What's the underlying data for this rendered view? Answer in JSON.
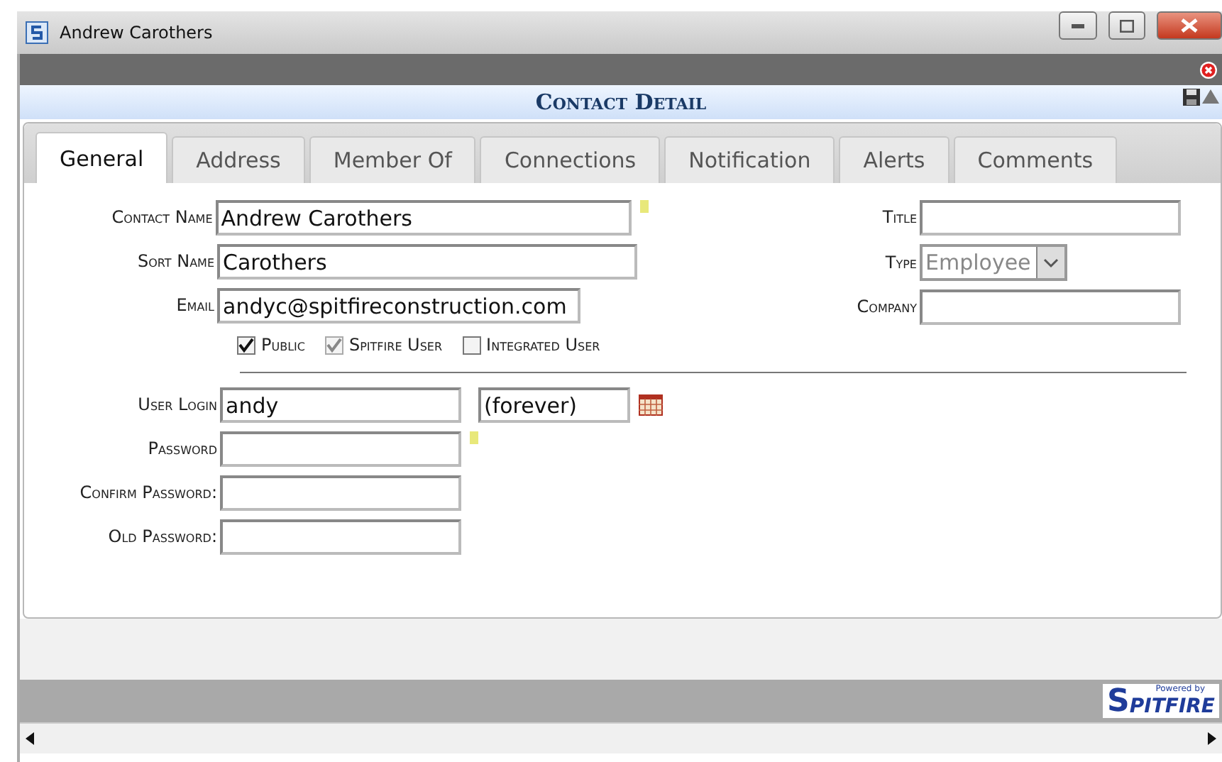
{
  "window": {
    "title": "Andrew Carothers"
  },
  "header": {
    "title": "Contact Detail"
  },
  "tabs": [
    {
      "label": "General",
      "selected": true
    },
    {
      "label": "Address",
      "selected": false
    },
    {
      "label": "Member Of",
      "selected": false
    },
    {
      "label": "Connections",
      "selected": false
    },
    {
      "label": "Notification",
      "selected": false
    },
    {
      "label": "Alerts",
      "selected": false
    },
    {
      "label": "Comments",
      "selected": false
    }
  ],
  "left_fields": [
    {
      "label": "Contact Name",
      "value": "Andrew Carothers",
      "help": true,
      "short": false
    },
    {
      "label": "Sort Name",
      "value": "Carothers",
      "help": false,
      "short": false
    },
    {
      "label": "Email",
      "value": "andyc@spitfireconstruction.com",
      "help": false,
      "short": true
    }
  ],
  "right_fields": [
    {
      "label": "Title",
      "kind": "text"
    },
    {
      "label": "Type",
      "kind": "select",
      "value": "Employee"
    },
    {
      "label": "Company",
      "kind": "text"
    }
  ],
  "checkboxes": [
    {
      "label": "Public",
      "checked": true,
      "disabled": false
    },
    {
      "label": "Spitfire User",
      "checked": true,
      "disabled": true
    },
    {
      "label": "Integrated User",
      "checked": false,
      "disabled": false
    }
  ],
  "login": {
    "label": "User Login",
    "value": "andy",
    "expiry": "(forever)"
  },
  "password_fields": [
    {
      "label": "Password",
      "help": true
    },
    {
      "label": "Confirm Password:",
      "help": false
    },
    {
      "label": "Old Password:",
      "help": false
    }
  ],
  "logo": {
    "tagline": "Powered by",
    "initial": "S",
    "rest": "PITFIRE"
  }
}
